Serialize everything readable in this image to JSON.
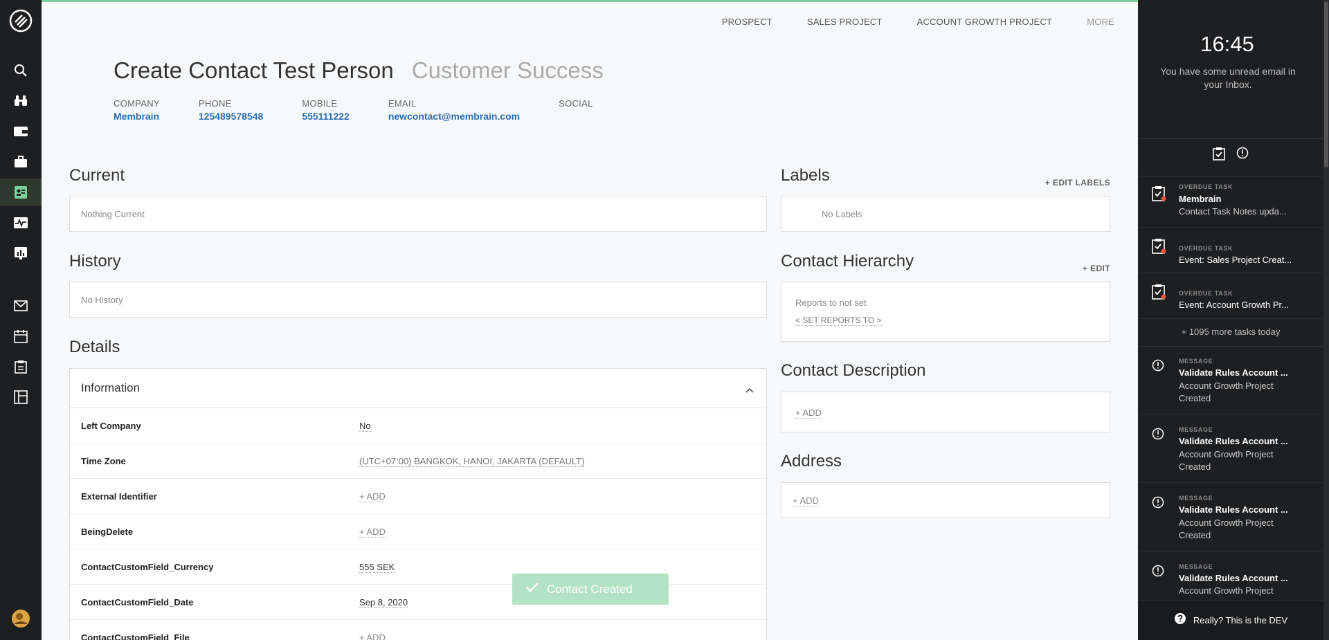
{
  "topnav": {
    "items": [
      "PROSPECT",
      "SALES PROJECT",
      "ACCOUNT GROWTH PROJECT"
    ],
    "more": "MORE"
  },
  "contact": {
    "name": "Create Contact Test Person",
    "role": "Customer Success"
  },
  "meta": {
    "company_label": "COMPANY",
    "company": "Membrain",
    "phone_label": "PHONE",
    "phone": "125489578548",
    "mobile_label": "MOBILE",
    "mobile": "555111222",
    "email_label": "EMAIL",
    "email": "newcontact@membrain.com",
    "social_label": "SOCIAL"
  },
  "current": {
    "title": "Current",
    "empty": "Nothing Current"
  },
  "history": {
    "title": "History",
    "empty": "No History"
  },
  "details": {
    "title": "Details",
    "section": "Information",
    "rows": [
      {
        "key": "Left Company",
        "value": "No"
      },
      {
        "key": "Time Zone",
        "value": "(UTC+07:00) BANGKOK, HANOI, JAKARTA (DEFAULT)"
      },
      {
        "key": "External Identifier",
        "value": "+ ADD"
      },
      {
        "key": "BeingDelete",
        "value": "+ ADD"
      },
      {
        "key": "ContactCustomField_Currency",
        "value": "555 SEK"
      },
      {
        "key": "ContactCustomField_Date",
        "value": "Sep 8, 2020"
      },
      {
        "key": "ContactCustomField_File",
        "value": "+ ADD"
      }
    ]
  },
  "labels": {
    "title": "Labels",
    "edit": "+ EDIT LABELS",
    "empty": "No Labels"
  },
  "hierarchy": {
    "title": "Contact Hierarchy",
    "edit": "+ EDIT",
    "reports": "Reports to not set",
    "set": "< SET REPORTS TO >"
  },
  "description": {
    "title": "Contact Description",
    "add": "+ ADD"
  },
  "address": {
    "title": "Address",
    "add": "+ ADD"
  },
  "toast": {
    "message": "Contact Created"
  },
  "panel": {
    "time": "16:45",
    "unread": "You have some unread email in your Inbox.",
    "tasks": [
      {
        "category": "OVERDUE TASK",
        "title": "Membrain",
        "text": "Contact Task Notes upda..."
      },
      {
        "category": "OVERDUE TASK",
        "text": "Event: Sales Project Creat..."
      },
      {
        "category": "OVERDUE TASK",
        "text": "Event: Account Growth Pr..."
      }
    ],
    "more_tasks": "+ 1095 more tasks today",
    "messages": [
      {
        "category": "MESSAGE",
        "title": "Validate Rules Account ...",
        "text": "Account Growth Project Created"
      },
      {
        "category": "MESSAGE",
        "title": "Validate Rules Account ...",
        "text": "Account Growth Project Created"
      },
      {
        "category": "MESSAGE",
        "title": "Validate Rules Account ...",
        "text": "Account Growth Project Created"
      },
      {
        "category": "MESSAGE",
        "title": "Validate Rules Account ...",
        "text": "Account Growth Project"
      }
    ],
    "footer": "Really? This is the DEV"
  },
  "colors": {
    "accent": "#7ccf9c",
    "link": "#2a6db3",
    "sidebar": "#1e1f21",
    "toast": "#b3e3c5"
  }
}
